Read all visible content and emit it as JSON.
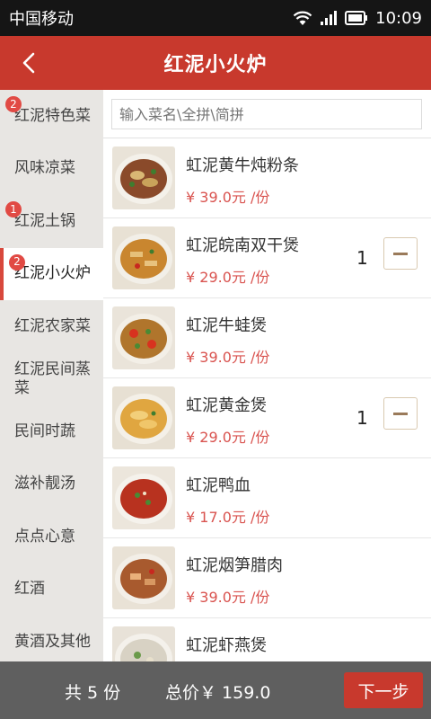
{
  "status_bar": {
    "carrier": "中国移动",
    "time": "10:09"
  },
  "header": {
    "title": "红泥小火炉"
  },
  "search": {
    "placeholder": "输入菜名\\全拼\\简拼"
  },
  "sidebar": {
    "categories": [
      {
        "label": "红泥特色菜",
        "badge": "2"
      },
      {
        "label": "风味凉菜"
      },
      {
        "label": "红泥土锅",
        "badge": "1"
      },
      {
        "label": "红泥小火炉",
        "badge": "2",
        "active": true
      },
      {
        "label": "红泥农家菜"
      },
      {
        "label": "红泥民间蒸菜"
      },
      {
        "label": "民间时蔬"
      },
      {
        "label": "滋补靓汤"
      },
      {
        "label": "点点心意"
      },
      {
        "label": "红酒"
      },
      {
        "label": "黄酒及其他"
      }
    ]
  },
  "dishes": [
    {
      "name": "虹泥黄牛炖粉条",
      "price": "¥ 39.0元 /份"
    },
    {
      "name": "虹泥皖南双干煲",
      "price": "¥ 29.0元 /份",
      "quantity": "1"
    },
    {
      "name": "虹泥牛蛙煲",
      "price": "¥ 39.0元 /份"
    },
    {
      "name": "虹泥黄金煲",
      "price": "¥ 29.0元 /份",
      "quantity": "1"
    },
    {
      "name": "虹泥鸭血",
      "price": "¥ 17.0元 /份"
    },
    {
      "name": "虹泥烟笋腊肉",
      "price": "¥ 39.0元 /份"
    },
    {
      "name": "虹泥虾燕煲",
      "price": ""
    }
  ],
  "footer": {
    "count": "共 5 份",
    "total": "总价￥ 159.0",
    "next_label": "下一步"
  }
}
